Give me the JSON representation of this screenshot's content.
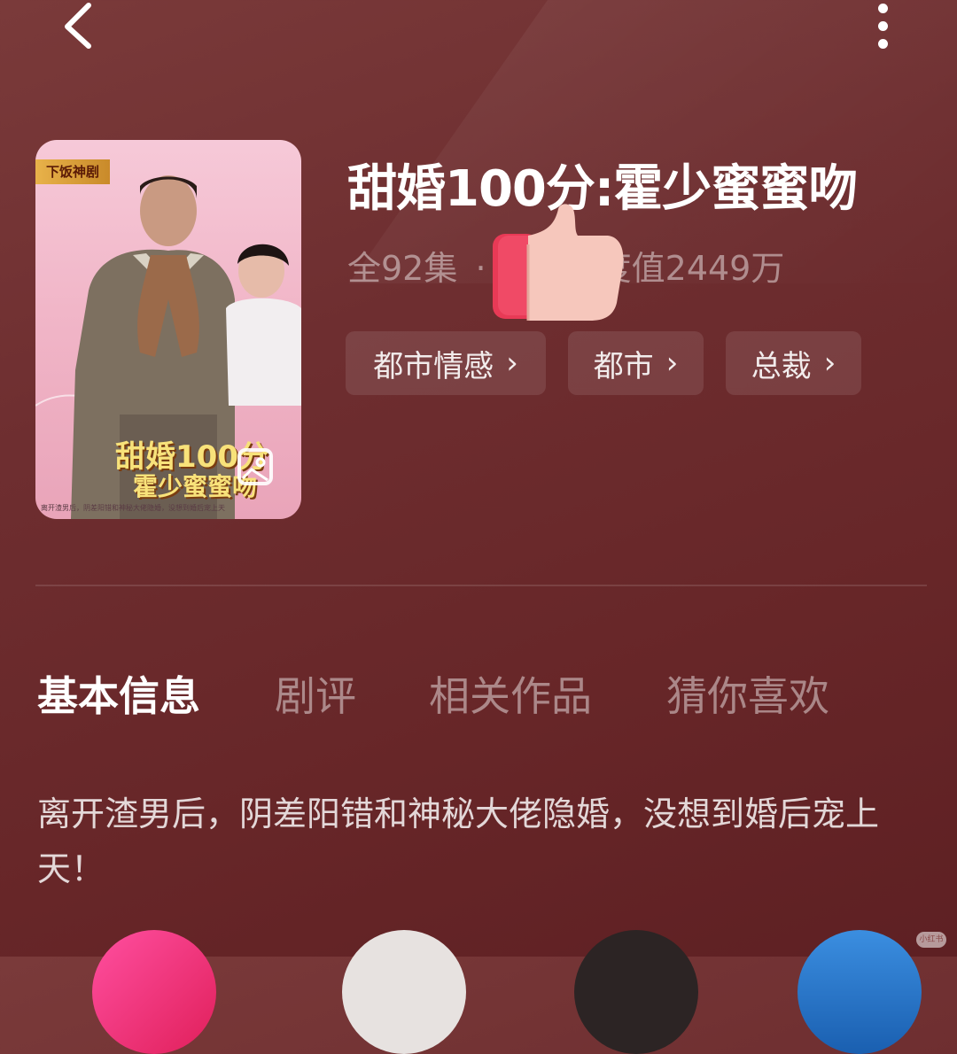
{
  "header": {
    "back_icon": "chevron-left-icon",
    "more_icon": "more-vertical-icon"
  },
  "poster": {
    "badge": "下饭神剧",
    "title_line1": "甜婚100分",
    "title_line2": "霍少蜜蜜吻",
    "tagline": "离开渣男后，阴差阳错和神秘大佬隐婚，没想到婚后宠上天",
    "overlay_icon": "image-icon"
  },
  "drama": {
    "title": "甜婚100分:霍少蜜蜜吻",
    "episodes": "全92集",
    "separator": "·",
    "heat": "热度值2449万"
  },
  "tags": [
    {
      "label": "都市情感",
      "chevron": "›"
    },
    {
      "label": "都市",
      "chevron": "›"
    },
    {
      "label": "总裁",
      "chevron": "›"
    }
  ],
  "tabs": [
    "基本信息",
    "剧评",
    "相关作品",
    "猜你喜欢"
  ],
  "description": "离开渣男后，阴差阳错和神秘大佬隐婚，没想到婚后宠上天！",
  "sticker": "thumbs-up-icon",
  "watermark": "小红书",
  "colors": {
    "background": "#6e2e30",
    "tag_bg": "rgba(255,255,255,0.1)",
    "sticker_red": "#e83a56",
    "sticker_skin": "#f6c7bc"
  }
}
